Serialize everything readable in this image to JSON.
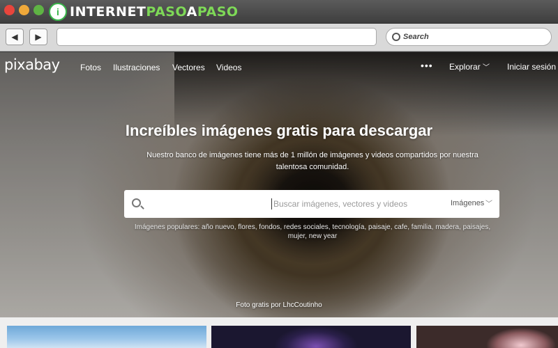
{
  "window": {
    "brand_mark": "i",
    "brand_part1": "INTERNET",
    "brand_part2": "PASO",
    "brand_part3": "A",
    "brand_part4": "PASO"
  },
  "toolbar": {
    "back_icon": "◀",
    "forward_icon": "▶",
    "search_label": "Search"
  },
  "site": {
    "logo": "pixabay",
    "nav": [
      "Fotos",
      "Ilustraciones",
      "Vectores",
      "Videos"
    ],
    "more": "•••",
    "explore": "Explorar",
    "login": "Iniciar sesión"
  },
  "hero": {
    "title": "Increíbles imágenes gratis para descargar",
    "subtitle": "Nuestro banco de imágenes tiene más de 1 millón de imágenes y videos compartidos por nuestra talentosa comunidad.",
    "search_placeholder": "Buscar imágenes, vectores y videos",
    "search_type": "Imágenes",
    "popular": "Imágenes populares: año nuevo, flores, fondos, redes sociales, tecnología, paisaje, cafe, familia, madera, paisajes, mujer, new year",
    "credit": "Foto gratis por LhcCoutinho"
  },
  "colors": {
    "brand_green": "#7ed957",
    "close": "#e8453c",
    "minimize": "#f0a93a",
    "zoom": "#5fb344"
  }
}
